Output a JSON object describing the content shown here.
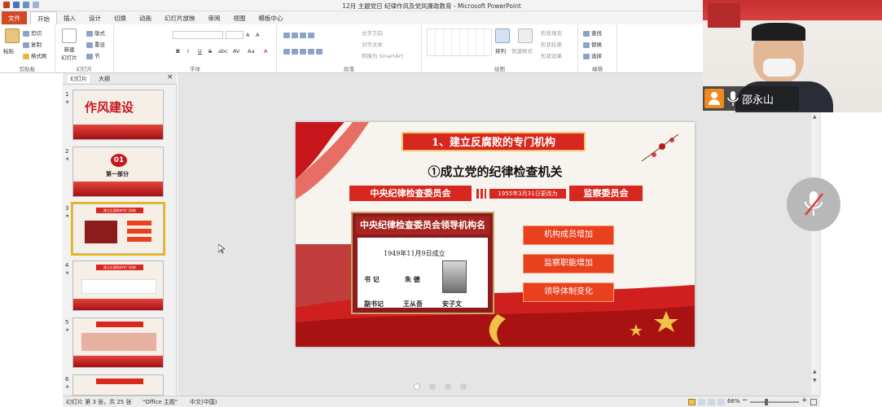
{
  "window": {
    "title": "12月 主题党日 纪律作风及党风廉政教育 - Microsoft PowerPoint"
  },
  "ribbon": {
    "tabs": [
      "文件",
      "开始",
      "插入",
      "设计",
      "切换",
      "动画",
      "幻灯片放映",
      "审阅",
      "视图",
      "模板中心"
    ],
    "active_tab": "开始",
    "clipboard": {
      "paste": "粘贴",
      "cut": "剪切",
      "copy": "复制",
      "format_painter": "格式刷",
      "label": "剪贴板"
    },
    "slides": {
      "new_slide": "新建\n幻灯片",
      "layout": "版式",
      "reset": "重设",
      "section": "节",
      "label": "幻灯片"
    },
    "font": {
      "label": "字体",
      "bold": "B",
      "italic": "I",
      "underline": "U",
      "strike": "S",
      "shadow": "abc",
      "spacing": "AV",
      "case": "Aa",
      "color": "A",
      "grow": "A",
      "shrink": "A"
    },
    "paragraph": {
      "label": "段落",
      "text_direction": "文字方向",
      "align_text": "对齐文本",
      "smartart": "转换为 SmartArt"
    },
    "drawing": {
      "label": "绘图",
      "arrange": "排列",
      "quick_styles": "快速样式",
      "shape_fill": "形状填充",
      "shape_outline": "形状轮廓",
      "shape_effects": "形状效果"
    },
    "editing": {
      "label": "编辑",
      "find": "查找",
      "replace": "替换",
      "select": "选择"
    }
  },
  "left_pane": {
    "tabs": [
      "幻灯片",
      "大纲"
    ],
    "active_tab": "幻灯片",
    "close": "×",
    "thumbnails": [
      {
        "num": "1",
        "text": "作风建设"
      },
      {
        "num": "2",
        "text": "第一部分",
        "badge": "01"
      },
      {
        "num": "3",
        "text": "建立反腐败的专门机构"
      },
      {
        "num": "4",
        "text": "建立反腐败的专门机构"
      },
      {
        "num": "5",
        "text": ""
      },
      {
        "num": "6",
        "text": ""
      }
    ],
    "selected": "3"
  },
  "slide": {
    "banner_title": "1、建立反腐败的专门机构",
    "subtitle": "①成立党的纪律检查机关",
    "left_tag": "中央纪律检查委员会",
    "date_note": "1955年3月31日更改为",
    "right_tag": "监察委员会",
    "board_title": "中央纪律检查委员会领导机构名单",
    "board_date": "1949年11月9日成立",
    "role1": "书  记",
    "name1": "朱  德",
    "role2": "副书记",
    "name2": "王从吾",
    "name3": "安子文",
    "buttons": [
      "机构成员增加",
      "监察职能增加",
      "领导体制变化"
    ]
  },
  "status": {
    "slide_info": "幻灯片 第 3 张，共 25 张",
    "theme": "\"Office 主题\"",
    "language": "中文(中国)",
    "zoom": "66%",
    "zoom_level": 0.66
  },
  "video": {
    "name": "邵永山"
  },
  "pager": {
    "count": 4,
    "active": 0
  },
  "colors": {
    "accent": "#d24726",
    "party_red": "#d7271e",
    "button_orange": "#e9411e"
  }
}
